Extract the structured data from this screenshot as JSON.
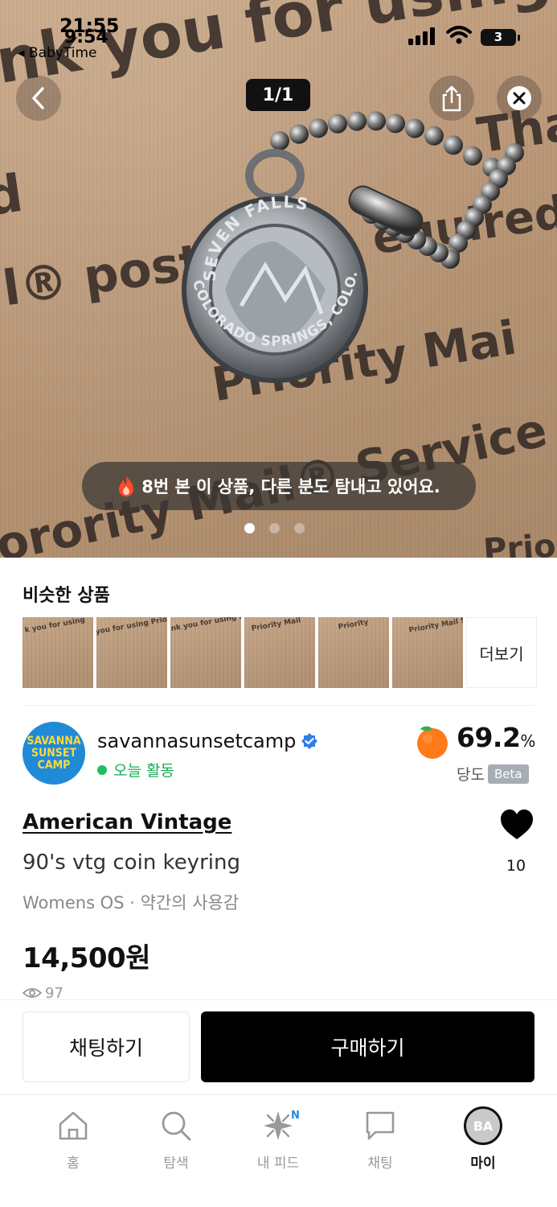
{
  "status_bar": {
    "time_top": "21:55",
    "time_bottom": "9:54",
    "back_app": "◂ BabyTime",
    "battery": "3"
  },
  "hero": {
    "counter": "1/1",
    "views_toast": "8번 본 이 상품, 다른 분도 탐내고 있어요.",
    "dots": 3,
    "active_dot": 0,
    "cardboard_text": [
      "nk you for using Pr",
      "d",
      "l® post",
      "Priority Mai",
      "orority Mail® Service",
      "Than",
      "Prio",
      "equired"
    ],
    "medal_top": "SEVEN FALLS",
    "medal_bottom": "COLORADO SPRINGS, COLO."
  },
  "similar": {
    "title": "비슷한 상품",
    "more_label": "더보기",
    "thumb_texts": [
      "k you for using",
      "you for using Priori",
      "nk you for using Pr",
      "Priority Mail",
      "Priority",
      "Priority Mail Service"
    ]
  },
  "seller": {
    "logo_lines": [
      "SAVANNA",
      "SUNSET",
      "CAMP"
    ],
    "name": "savannasunsetcamp",
    "activity": "오늘 활동",
    "score": "69.2",
    "score_unit": "%",
    "score_label": "당도",
    "beta": "Beta"
  },
  "product": {
    "brand": "American Vintage",
    "title": "90's vtg coin keyring",
    "meta": "Womens OS · 약간의 사용감",
    "price": "14,500원",
    "views": "97",
    "likes": "10"
  },
  "actions": {
    "chat": "채팅하기",
    "buy": "구매하기"
  },
  "tabs": [
    {
      "label": "홈"
    },
    {
      "label": "탐색"
    },
    {
      "label": "내 피드",
      "badge": "N"
    },
    {
      "label": "채팅"
    },
    {
      "label": "마이",
      "avatar": "BA"
    }
  ]
}
